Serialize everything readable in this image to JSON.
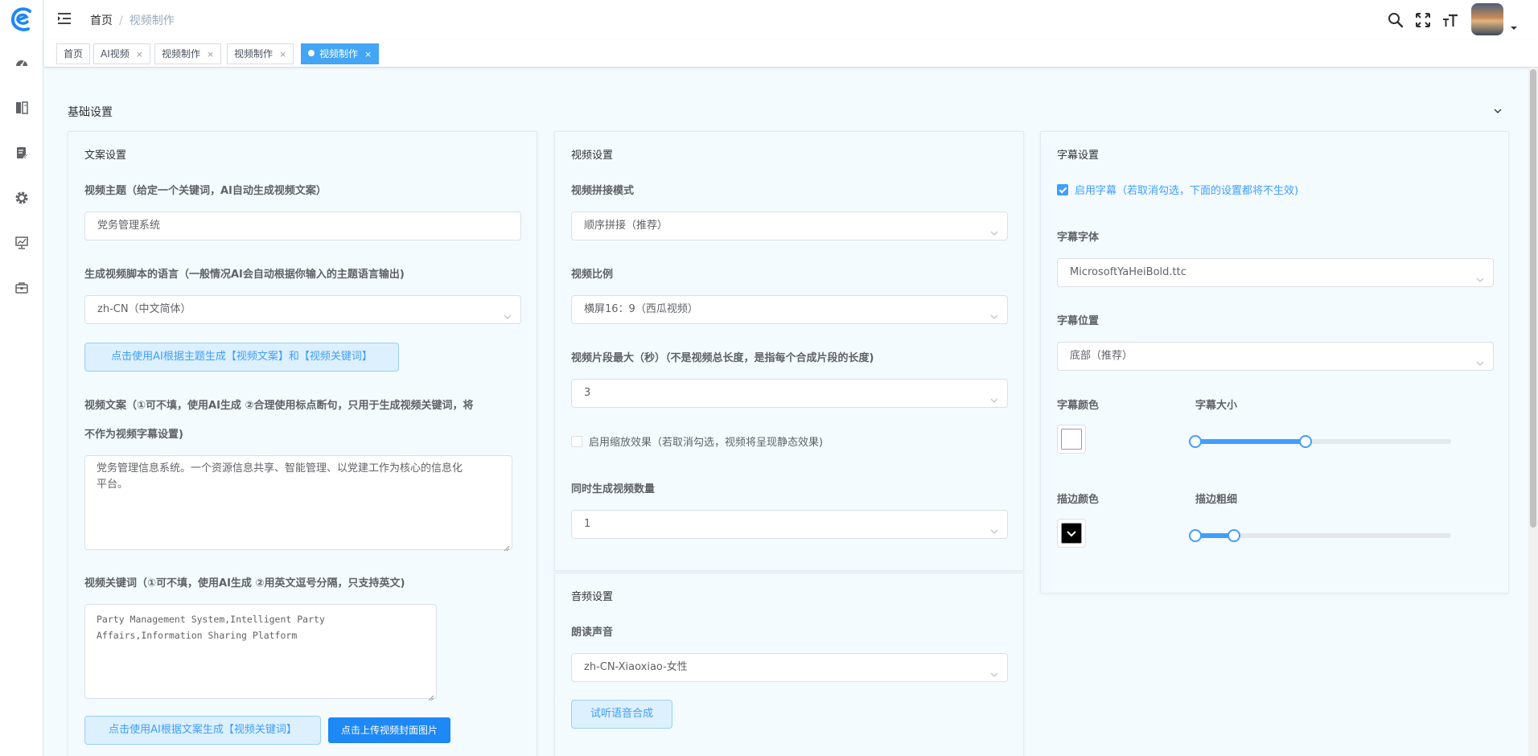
{
  "header": {
    "breadcrumb_home": "首页",
    "breadcrumb_sep": "/",
    "breadcrumb_current": "视频制作"
  },
  "tags": [
    {
      "label": "首页"
    },
    {
      "label": "AI视频"
    },
    {
      "label": "视频制作"
    },
    {
      "label": "视频制作"
    },
    {
      "label": "视频制作"
    }
  ],
  "tag_close": "×",
  "section": {
    "title": "基础设置"
  },
  "copy": {
    "title": "文案设置",
    "topic_label": "视频主题（给定一个关键词，AI自动生成视频文案）",
    "topic_value": "党务管理系统",
    "lang_label": "生成视频脚本的语言（一般情况AI会自动根据你输入的主题语言输出)",
    "lang_value": "zh-CN（中文简体）",
    "gen_btn": "点击使用AI根据主题生成【视频文案】和【视频关键词】",
    "script_label_1": "视频文案（①可不填，使用AI生成 ②合理使用标点断句，只用于生成视频关键词，将",
    "script_label_2": "不作为视频字幕设置)",
    "script_line_1": "党务管理信息系统。一个资源信息共享、智能管理、以党建工作为核心的信息化",
    "script_line_2": "平台。",
    "kw_label": "视频关键词（①可不填，使用AI生成 ②用英文逗号分隔，只支持英文)",
    "kw_line_1": "Party Management System,Intelligent Party",
    "kw_line_2": "Affairs,Information Sharing Platform",
    "kw_btn": "点击使用AI根据文案生成【视频关键词】",
    "cover_btn": "点击上传视频封面图片"
  },
  "video": {
    "title": "视频设置",
    "concat_label": "视频拼接模式",
    "concat_value": "顺序拼接（推荐）",
    "ratio_label": "视频比例",
    "ratio_value": "横屏16：9（西瓜视频）",
    "clip_label": "视频片段最大（秒）（不是视频总长度，是指每个合成片段的长度)",
    "clip_value": "3",
    "zoom_label": "启用缩放效果（若取消勾选，视频将呈现静态效果)",
    "zoom_checked": false,
    "count_label": "同时生成视频数量",
    "count_value": "1"
  },
  "audio": {
    "title": "音频设置",
    "voice_label": "朗读声音",
    "voice_value": "zh-CN-Xiaoxiao-女性",
    "preview_btn": "试听语音合成"
  },
  "subtitle": {
    "title": "字幕设置",
    "enable_label": "启用字幕（若取消勾选，下面的设置都将不生效)",
    "enable_checked": true,
    "font_label": "字幕字体",
    "font_value": "MicrosoftYaHeiBold.ttc",
    "pos_label": "字幕位置",
    "pos_value": "底部（推荐）",
    "color_label": "字幕颜色",
    "color_value": "#ffffff",
    "size_label": "字幕大小",
    "size_fraction": 0.43,
    "stroke_color_label": "描边颜色",
    "stroke_color_value": "#000000",
    "stroke_width_label": "描边粗细",
    "stroke_width_fraction": 0.15
  }
}
